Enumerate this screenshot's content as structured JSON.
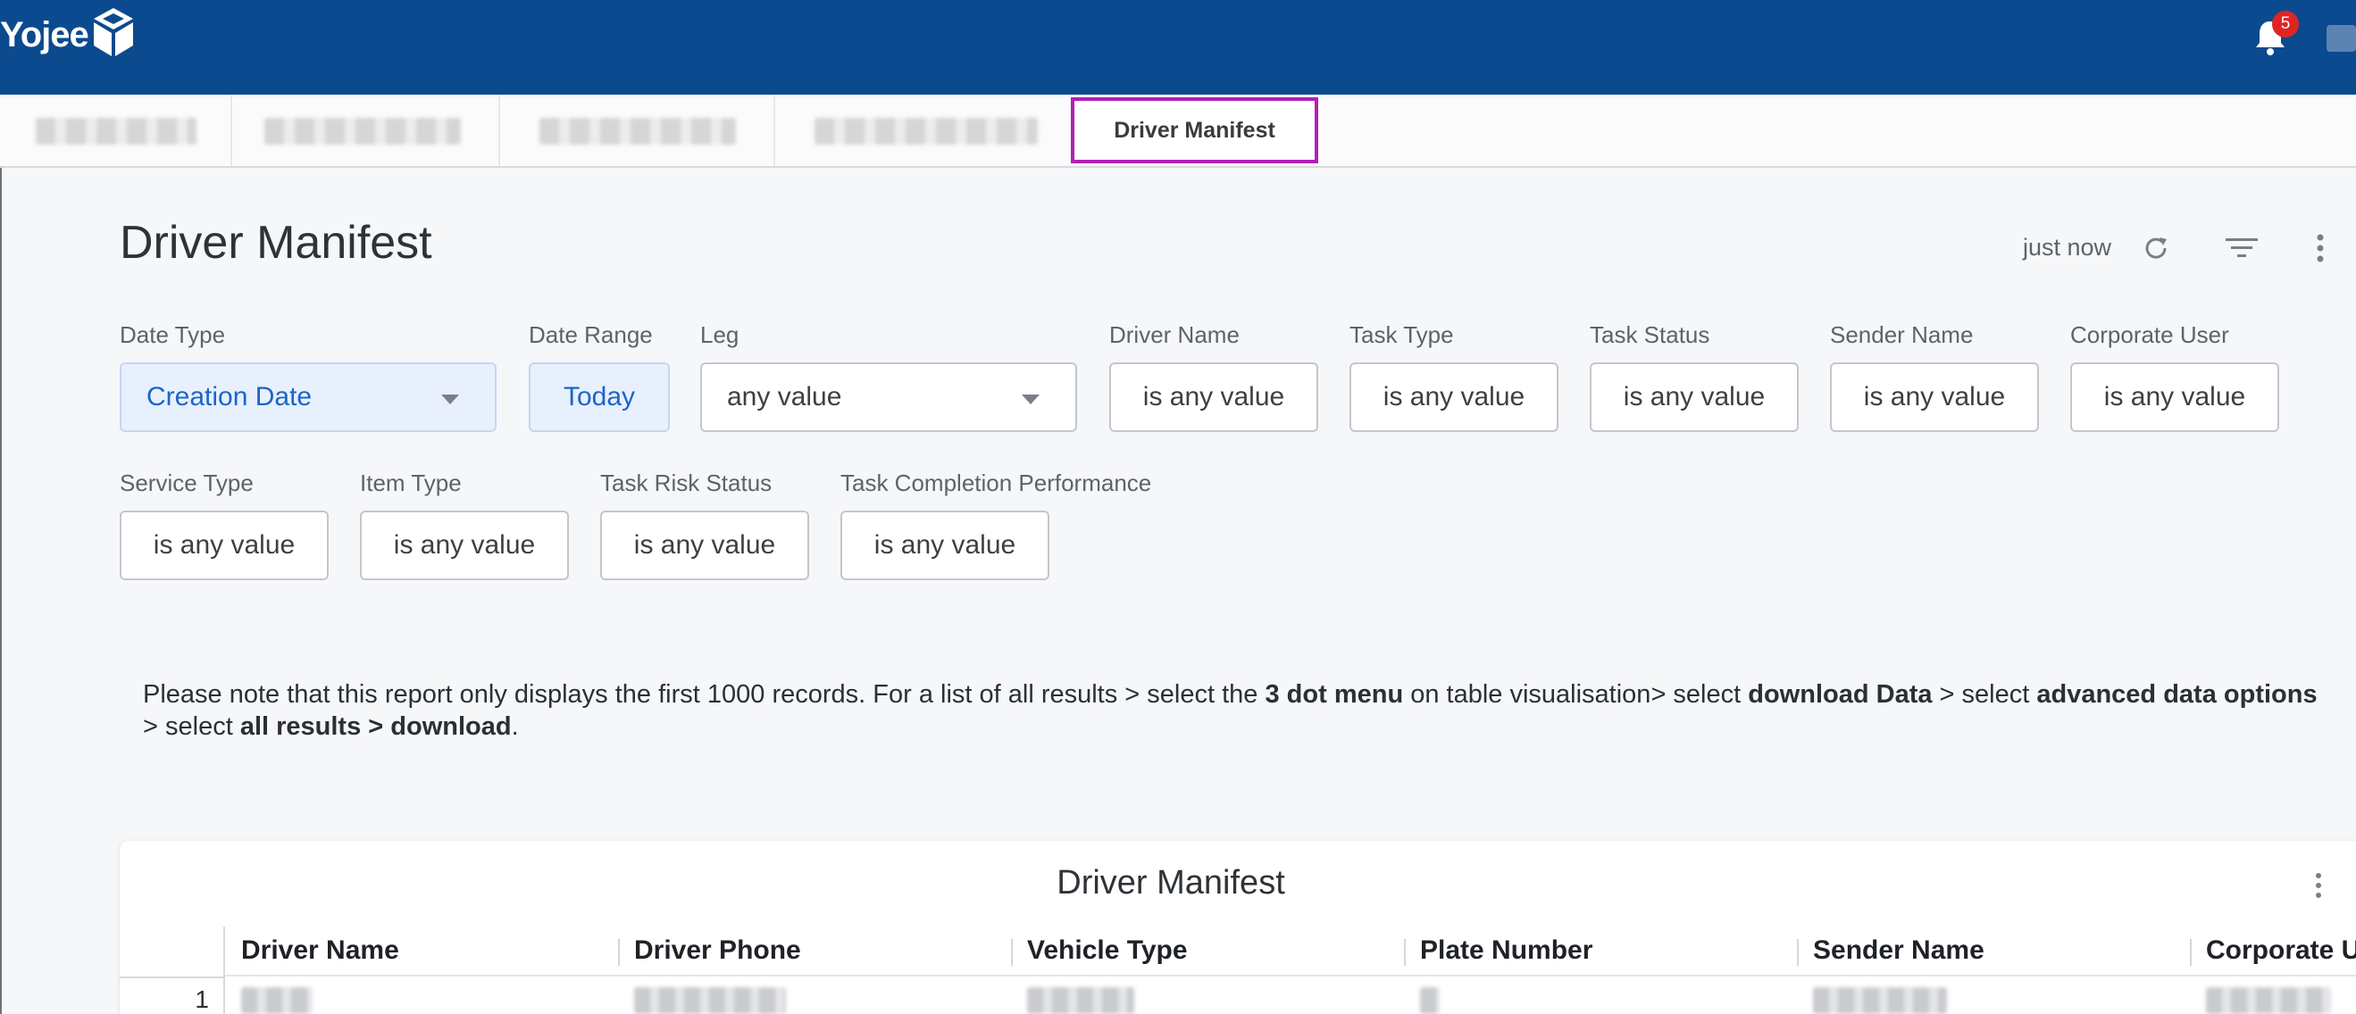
{
  "header": {
    "logo_text": "Yojee",
    "notification_count": "5",
    "icons": {
      "logo": "yojee-cube-logo",
      "notifications": "bell-icon",
      "avatar": "user-avatar"
    }
  },
  "tabs": {
    "active_label": "Driver Manifest"
  },
  "page": {
    "title": "Driver Manifest",
    "last_refresh": "just now",
    "icons": {
      "refresh": "refresh-icon",
      "filter": "filter-icon",
      "more": "more-vertical-icon"
    }
  },
  "filters": [
    {
      "label": "Date Type",
      "value": "Creation Date",
      "kind": "dropdown",
      "selected": true
    },
    {
      "label": "Date Range",
      "value": "Today",
      "kind": "button",
      "selected": true
    },
    {
      "label": "Leg",
      "value": "any value",
      "kind": "dropdown",
      "selected": false
    },
    {
      "label": "Driver Name",
      "value": "is any value",
      "kind": "button",
      "selected": false
    },
    {
      "label": "Task Type",
      "value": "is any value",
      "kind": "button",
      "selected": false
    },
    {
      "label": "Task Status",
      "value": "is any value",
      "kind": "button",
      "selected": false
    },
    {
      "label": "Sender Name",
      "value": "is any value",
      "kind": "button",
      "selected": false
    },
    {
      "label": "Corporate User",
      "value": "is any value",
      "kind": "button",
      "selected": false
    },
    {
      "label": "Service Type",
      "value": "is any value",
      "kind": "button",
      "selected": false
    },
    {
      "label": "Item Type",
      "value": "is any value",
      "kind": "button",
      "selected": false
    },
    {
      "label": "Task Risk Status",
      "value": "is any value",
      "kind": "button",
      "selected": false
    },
    {
      "label": "Task Completion Performance",
      "value": "is any value",
      "kind": "button",
      "selected": false
    }
  ],
  "note": {
    "part1": "Please note that this report only displays the first 1000 records. For a list of all results > select the ",
    "bold1": "3 dot menu",
    "part2": " on table visualisation> select ",
    "bold2": "download Data",
    "part3": " > select ",
    "bold3": "advanced data options",
    "part4": " > select ",
    "bold4": "all results > download",
    "part5": "."
  },
  "table": {
    "title": "Driver Manifest",
    "columns": [
      "Driver Name",
      "Driver Phone",
      "Vehicle Type",
      "Plate Number",
      "Sender Name",
      "Corporate U"
    ],
    "rows": [
      {
        "index": "1"
      }
    ]
  },
  "colors": {
    "topbar": "#0b4a8f",
    "active_tab_outline": "#b21fb5",
    "selected_filter_text": "#1a66c8",
    "badge": "#e02424"
  }
}
